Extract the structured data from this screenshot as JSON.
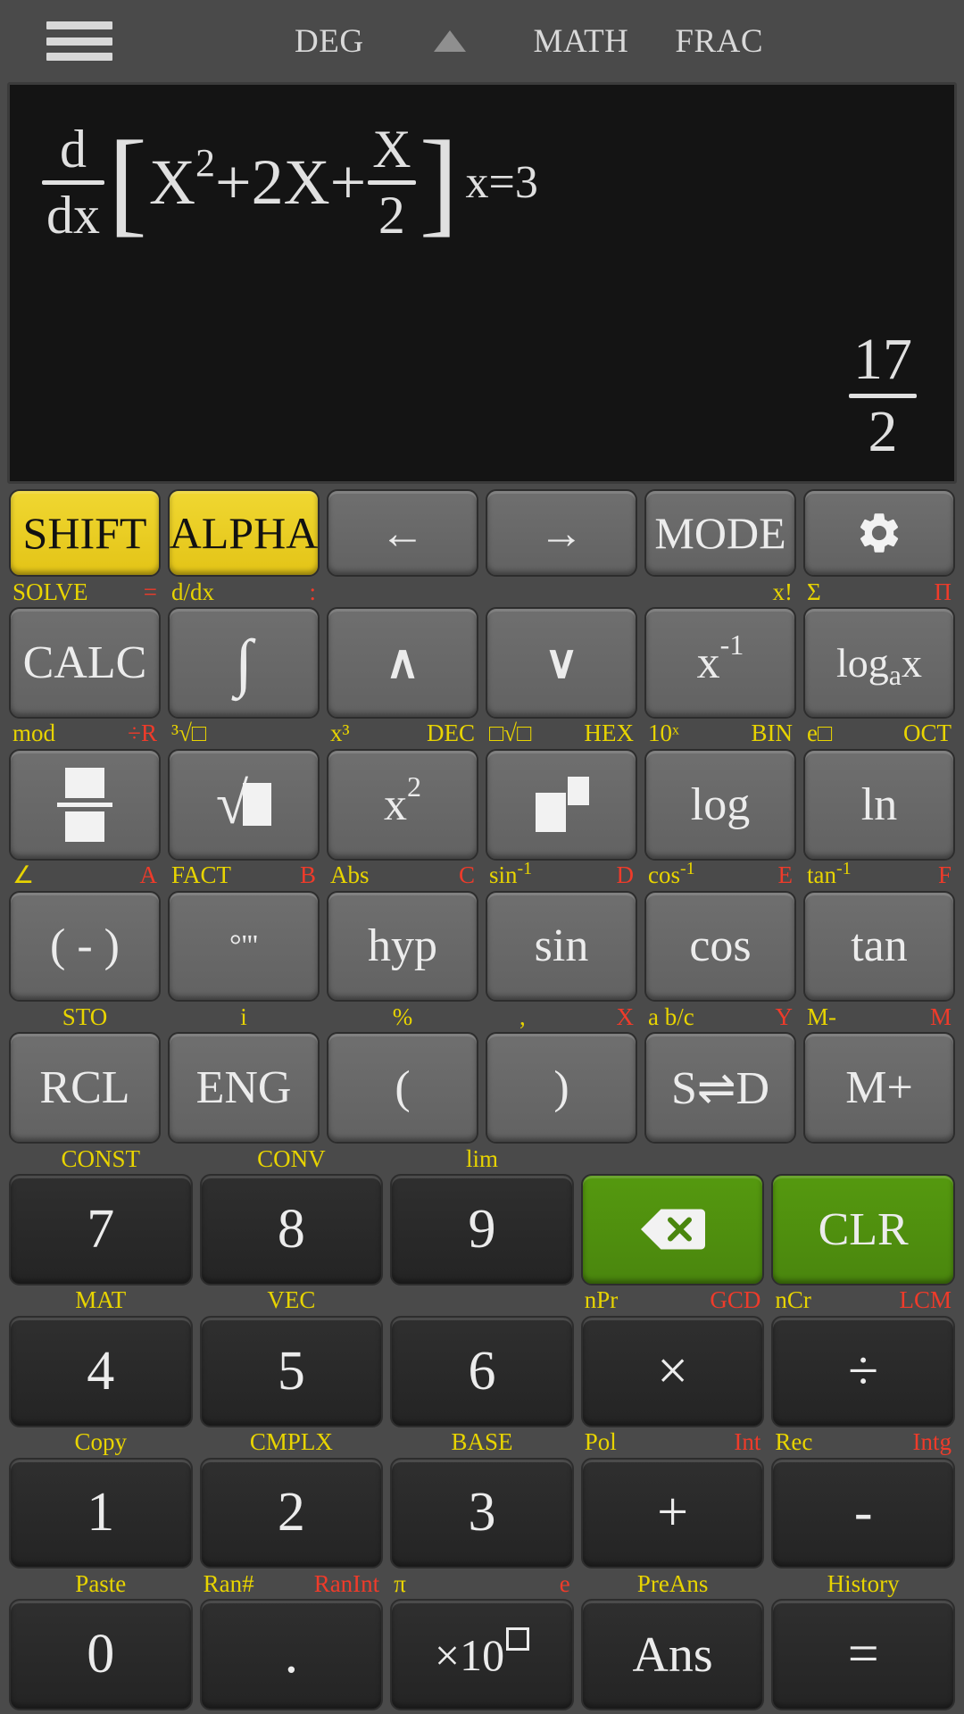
{
  "topbar": {
    "menu_icon": "hamburger-icon",
    "indicators": [
      "DEG",
      "MATH",
      "FRAC"
    ],
    "deg": "DEG",
    "math": "MATH",
    "frac": "FRAC",
    "arrow_icon": "triangle-up-icon"
  },
  "display": {
    "expression": {
      "operator_num": "d",
      "operator_den": "dx",
      "open_bracket": "[",
      "term1_base": "X",
      "term1_exp": "2",
      "plus1": "+",
      "term2": "2X",
      "plus2": "+",
      "frac_num": "X",
      "frac_den": "2",
      "close_bracket": "]",
      "evaluate_at": "x=3",
      "full_text": "d/dx[X^2+2X+X/2] x=3"
    },
    "result": {
      "numerator": "17",
      "denominator": "2",
      "full_text": "17/2"
    }
  },
  "colors": {
    "background": "#4a4a4a",
    "display_bg": "#141414",
    "button_gray": "#6b6b6b",
    "button_dark": "#2b2b2b",
    "accent_yellow": "#e8d400",
    "accent_red": "#ef3b2a",
    "accent_green": "#4e900e",
    "text_light": "#ececec"
  },
  "keys": {
    "row1": [
      {
        "label": "SHIFT",
        "style": "yellow",
        "shift": "",
        "alpha": ""
      },
      {
        "label": "ALPHA",
        "style": "yellow",
        "shift": "",
        "alpha": ""
      },
      {
        "label": "←",
        "style": "gray",
        "icon": "arrow-left-icon",
        "shift": "",
        "alpha": ""
      },
      {
        "label": "→",
        "style": "gray",
        "icon": "arrow-right-icon",
        "shift": "",
        "alpha": ""
      },
      {
        "label": "MODE",
        "style": "gray",
        "shift": "",
        "alpha": ""
      },
      {
        "label": "",
        "style": "gray",
        "icon": "gear-icon",
        "shift": "",
        "alpha": ""
      }
    ],
    "row2": [
      {
        "label": "CALC",
        "style": "gray",
        "shift": "SOLVE",
        "alpha": "="
      },
      {
        "label": "∫",
        "style": "gray",
        "shift": "d/dx",
        "alpha": ":"
      },
      {
        "label": "∧",
        "style": "gray",
        "icon": "chevron-up-icon",
        "shift": "",
        "alpha": ""
      },
      {
        "label": "∨",
        "style": "gray",
        "icon": "chevron-down-icon",
        "shift": "",
        "alpha": ""
      },
      {
        "label": "x-1",
        "style": "gray",
        "shift": "x!",
        "alpha": ""
      },
      {
        "label": "logax",
        "style": "gray",
        "shift": "Σ",
        "alpha": "Π"
      }
    ],
    "row3": [
      {
        "label": "",
        "style": "gray",
        "icon": "fraction-icon",
        "shift": "mod",
        "alpha": "÷R"
      },
      {
        "label": "",
        "style": "gray",
        "icon": "sqrt-icon",
        "shift": "³√□",
        "alpha": ""
      },
      {
        "label": "x2",
        "style": "gray",
        "shift": "x³",
        "alpha": "DEC",
        "alpha_color": "yellow"
      },
      {
        "label": "",
        "style": "gray",
        "icon": "power-icon",
        "shift": "□√□",
        "alpha": "HEX",
        "alpha_color": "yellow"
      },
      {
        "label": "log",
        "style": "gray",
        "shift": "10ˣ",
        "alpha": "BIN",
        "alpha_color": "yellow"
      },
      {
        "label": "ln",
        "style": "gray",
        "shift": "e□",
        "alpha": "OCT",
        "alpha_color": "yellow"
      }
    ],
    "row4": [
      {
        "label": "( - )",
        "style": "gray",
        "shift": "∠",
        "alpha": "A"
      },
      {
        "label": "°'''",
        "style": "gray",
        "shift": "FACT",
        "alpha": "B"
      },
      {
        "label": "hyp",
        "style": "gray",
        "shift": "Abs",
        "alpha": "C"
      },
      {
        "label": "sin",
        "style": "gray",
        "shift": "sin-1",
        "alpha": "D"
      },
      {
        "label": "cos",
        "style": "gray",
        "shift": "cos-1",
        "alpha": "E"
      },
      {
        "label": "tan",
        "style": "gray",
        "shift": "tan-1",
        "alpha": "F"
      }
    ],
    "row5": [
      {
        "label": "RCL",
        "style": "gray",
        "shift": "STO",
        "alpha": ""
      },
      {
        "label": "ENG",
        "style": "gray",
        "shift": "i",
        "alpha": ""
      },
      {
        "label": "(",
        "style": "gray",
        "shift": "%",
        "alpha": ""
      },
      {
        "label": ")",
        "style": "gray",
        "shift": ",",
        "alpha": "X"
      },
      {
        "label": "S⇌D",
        "style": "gray",
        "shift": "a b/c",
        "alpha": "Y"
      },
      {
        "label": "M+",
        "style": "gray",
        "shift": "M-",
        "alpha": "M"
      }
    ],
    "row6": [
      {
        "label": "7",
        "style": "dark",
        "shift": "CONST",
        "alpha": ""
      },
      {
        "label": "8",
        "style": "dark",
        "shift": "CONV",
        "alpha": ""
      },
      {
        "label": "9",
        "style": "dark",
        "shift": "lim",
        "alpha": ""
      },
      {
        "label": "",
        "style": "green",
        "icon": "backspace-icon",
        "shift": "",
        "alpha": ""
      },
      {
        "label": "CLR",
        "style": "green",
        "shift": "",
        "alpha": ""
      }
    ],
    "row7": [
      {
        "label": "4",
        "style": "dark",
        "shift": "MAT",
        "alpha": ""
      },
      {
        "label": "5",
        "style": "dark",
        "shift": "VEC",
        "alpha": ""
      },
      {
        "label": "6",
        "style": "dark",
        "shift": "",
        "alpha": ""
      },
      {
        "label": "×",
        "style": "dark",
        "shift": "nPr",
        "alpha": "GCD"
      },
      {
        "label": "÷",
        "style": "dark",
        "shift": "nCr",
        "alpha": "LCM"
      }
    ],
    "row8": [
      {
        "label": "1",
        "style": "dark",
        "shift": "Copy",
        "alpha": ""
      },
      {
        "label": "2",
        "style": "dark",
        "shift": "CMPLX",
        "alpha": ""
      },
      {
        "label": "3",
        "style": "dark",
        "shift": "BASE",
        "alpha": ""
      },
      {
        "label": "+",
        "style": "dark",
        "shift": "Pol",
        "alpha": "Int"
      },
      {
        "label": "-",
        "style": "dark",
        "shift": "Rec",
        "alpha": "Intg"
      }
    ],
    "row9": [
      {
        "label": "0",
        "style": "dark",
        "shift": "Paste",
        "alpha": ""
      },
      {
        "label": ".",
        "style": "dark",
        "shift": "Ran#",
        "alpha": "RanInt"
      },
      {
        "label": "×10□",
        "style": "dark",
        "shift": "π",
        "alpha": "e"
      },
      {
        "label": "Ans",
        "style": "dark",
        "shift": "PreAns",
        "alpha": ""
      },
      {
        "label": "=",
        "style": "dark",
        "shift": "History",
        "alpha": ""
      }
    ]
  }
}
